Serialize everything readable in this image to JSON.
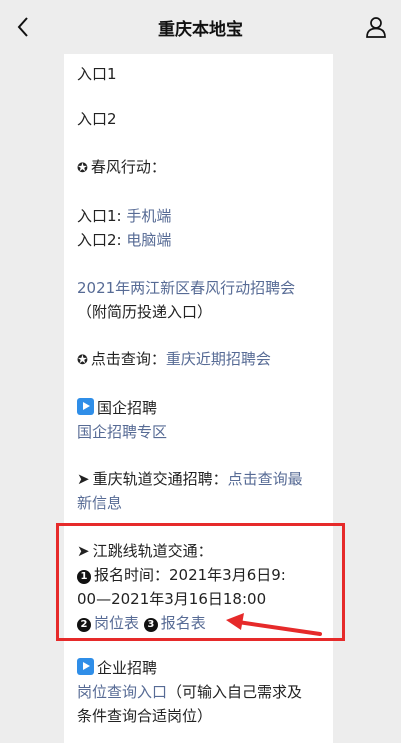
{
  "header": {
    "title": "重庆本地宝",
    "back_icon": "chevron-left-icon",
    "user_icon": "user-icon"
  },
  "article": {
    "entry1": "入口1",
    "entry2": "入口2",
    "spring_heading": "春风行动：",
    "mobile_prefix": "入口1: ",
    "mobile_link": "手机端",
    "pc_prefix": "入口2: ",
    "pc_link": "电脑端",
    "fair_link": "2021年两江新区春风行动招聘会",
    "fair_note": "（附简历投递入口）",
    "query_prefix": "点击查询：",
    "query_link": "重庆近期招聘会",
    "soe_heading": "国企招聘",
    "soe_link": "国企招聘专区",
    "rail_prefix": "重庆轨道交通招聘：",
    "rail_link_1": "点击查询最",
    "rail_link_2": "新信息",
    "jiang_heading": "江跳线轨道交通：",
    "bullet1": "1",
    "reg_time_1": "报名时间：2021年3月6日9:",
    "reg_time_2": "00—2021年3月16日18:00",
    "bullet2": "2",
    "position_link": "岗位表",
    "bullet3": "3",
    "form_link": "报名表",
    "corp_heading": "企业招聘",
    "corp_link": "岗位查询入口",
    "corp_note_1": "（可输入自己需求及",
    "corp_note_2": "条件查询合适岗位）"
  },
  "annotation": {
    "box_color": "#e62a2a",
    "arrow_color": "#e62a2a"
  }
}
